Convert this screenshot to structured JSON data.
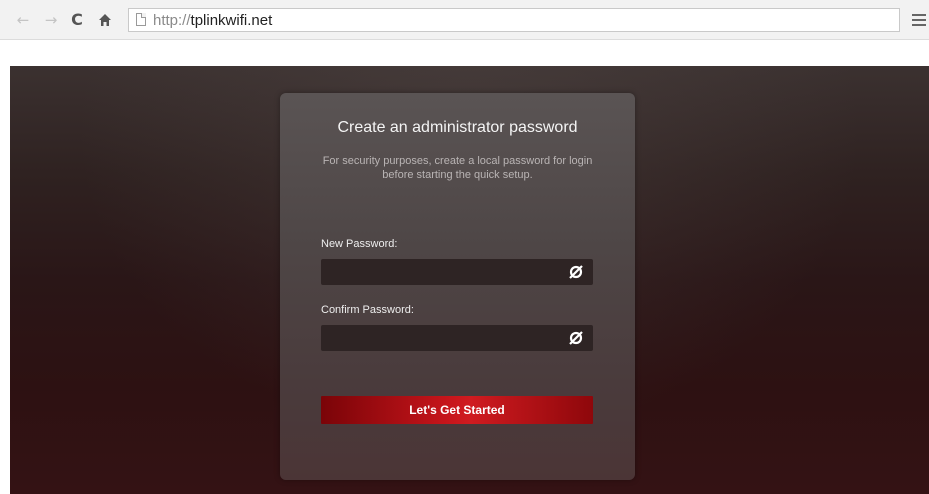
{
  "browser": {
    "back_icon": "arrow-left-icon",
    "forward_icon": "arrow-right-icon",
    "reload_icon": "reload-icon",
    "home_icon": "home-icon",
    "url_scheme": "http://",
    "url_host": "tplinkwifi.net",
    "menu_icon": "hamburger-menu-icon"
  },
  "card": {
    "title": "Create an administrator password",
    "description": "For security purposes, create a local password for login before starting the quick setup.",
    "new_password_label": "New Password:",
    "new_password_value": "",
    "confirm_password_label": "Confirm Password:",
    "confirm_password_value": "",
    "visibility_icon": "eye-slash-icon",
    "submit_label": "Let's Get Started"
  },
  "colors": {
    "accent_button": "#c4141a",
    "card_background": "#4e4646",
    "page_background": "#2a1617"
  }
}
